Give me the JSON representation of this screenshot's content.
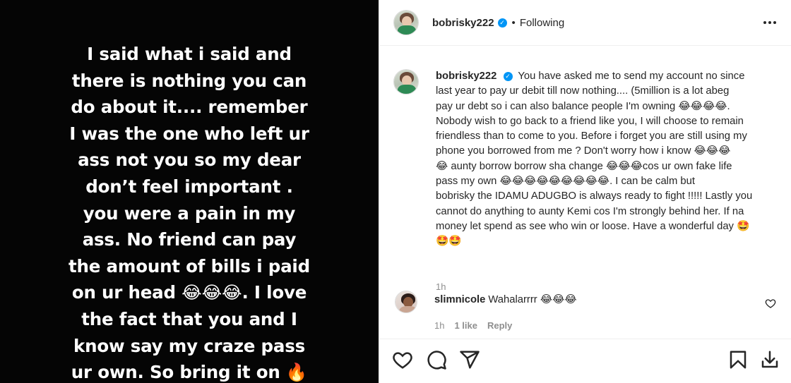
{
  "story": {
    "text": "I said what i said and\nthere is nothing you can\ndo about it.... remember\nI was the one who left ur\nass not you so my dear\ndon’t feel important .\nyou were a pain in my\nass. No friend can pay\nthe amount of bills i paid\non ur head 😂😂😂. I love\nthe fact that you and I\nknow say my craze pass\nur own. So bring it on 🔥"
  },
  "header": {
    "username": "bobrisky222",
    "separator": "•",
    "follow_state": "Following",
    "verified_icon": "verified-badge-icon",
    "more_icon": "more-options-icon"
  },
  "caption": {
    "username": "bobrisky222",
    "text": "You have asked me to send my account no since\nlast year to pay ur debit till now nothing.... (5million is a lot abeg\npay ur debt so i can also balance people I'm owning 😂😂😂😂.\nNobody wish to go back to a friend like you, I will choose to remain\nfriendless than to come to you. Before i forget you are still using my\nphone you borrowed from me ? Don't worry how i know 😂😂😂\n😂 aunty borrow borrow sha change 😂😂😂cos ur own fake life\npass my own 😂😂😂😂😂😂😂😂😂. I can be calm but\nbobrisky the IDAMU ADUGBO is always ready to fight !!!!! Lastly you\ncannot do anything to aunty Kemi cos I'm strongly behind her. If na\nmoney let spend as see who win or loose. Have a wonderful day 🤩\n🤩🤩",
    "time": "1h"
  },
  "comment": {
    "username": "slimnicole",
    "text": "Wahalarrrr 😂😂😂",
    "time": "1h",
    "likes": "1 like",
    "reply": "Reply",
    "like_icon": "heart-outline-icon"
  },
  "actions": {
    "icons": [
      "heart-icon",
      "comment-icon",
      "share-icon",
      "bookmark-icon",
      "download-icon"
    ]
  },
  "colors": {
    "verified": "#0095f6",
    "text": "#262626",
    "muted": "#8e8e8e",
    "divider": "#efefef",
    "story_bg": "#050505"
  }
}
